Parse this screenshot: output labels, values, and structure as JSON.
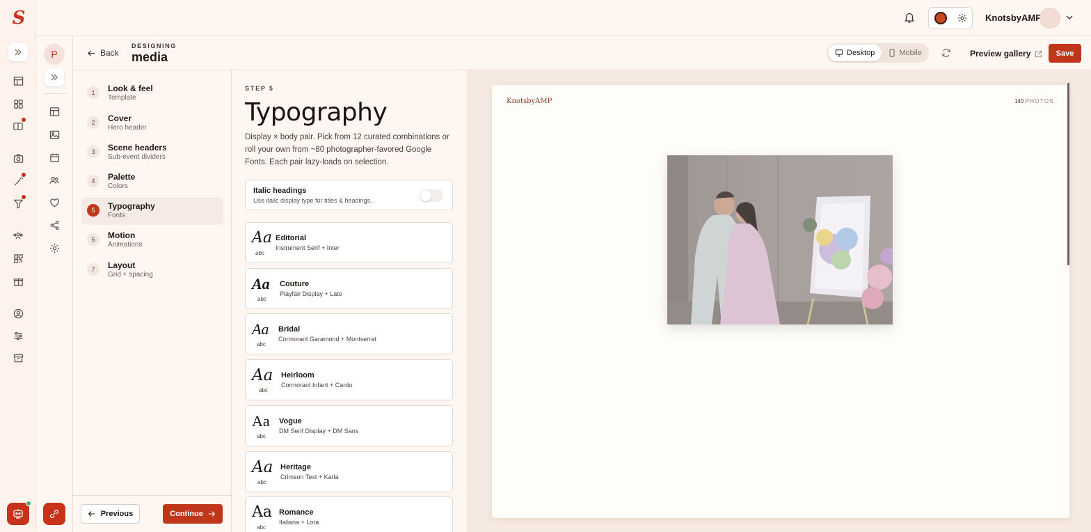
{
  "app": {
    "logo": "S"
  },
  "topbar": {
    "username": "KnotsbyAMP",
    "accent_color": "#c8481e"
  },
  "subrail": {
    "project_initial": "P"
  },
  "header": {
    "back_label": "Back",
    "eyebrow": "DESIGNING",
    "project_name": "media",
    "devices": [
      {
        "label": "Desktop",
        "active": true
      },
      {
        "label": "Mobile",
        "active": false
      }
    ],
    "preview_label": "Preview gallery",
    "save_label": "Save"
  },
  "steps": [
    {
      "num": "1",
      "title": "Look & feel",
      "subtitle": "Template"
    },
    {
      "num": "2",
      "title": "Cover",
      "subtitle": "Hero header"
    },
    {
      "num": "3",
      "title": "Scene headers",
      "subtitle": "Sub-event dividers"
    },
    {
      "num": "4",
      "title": "Palette",
      "subtitle": "Colors"
    },
    {
      "num": "5",
      "title": "Typography",
      "subtitle": "Fonts"
    },
    {
      "num": "6",
      "title": "Motion",
      "subtitle": "Animations"
    },
    {
      "num": "7",
      "title": "Layout",
      "subtitle": "Grid + spacing"
    }
  ],
  "active_step": 5,
  "footer": {
    "previous_label": "Previous",
    "continue_label": "Continue"
  },
  "panel": {
    "step_label": "STEP 5",
    "title": "Typography",
    "description": "Display × body pair. Pick from 12 curated combinations or roll your own from ~80 photographer-favored Google Fonts. Each pair lazy-loads on selection.",
    "italic_toggle": {
      "title": "Italic headings",
      "subtitle": "Use italic display type for titles & headings.",
      "enabled": false
    },
    "sample_glyph": "Aa",
    "sample_small": "abc",
    "pairs": [
      {
        "name": "Editorial",
        "fonts": "Instrument Serif + Inter"
      },
      {
        "name": "Couture",
        "fonts": "Playfair Display + Lato"
      },
      {
        "name": "Bridal",
        "fonts": "Cormorant Garamond + Montserrat"
      },
      {
        "name": "Heirloom",
        "fonts": "Cormorant Infant + Cardo"
      },
      {
        "name": "Vogue",
        "fonts": "DM Serif Display + DM Sans"
      },
      {
        "name": "Heritage",
        "fonts": "Crimson Text + Karla"
      },
      {
        "name": "Romance",
        "fonts": "Italiana + Lora"
      }
    ]
  },
  "preview": {
    "brand": "KnotsbyAMP",
    "photo_count": "140",
    "photo_count_label": "PHOTOS"
  }
}
